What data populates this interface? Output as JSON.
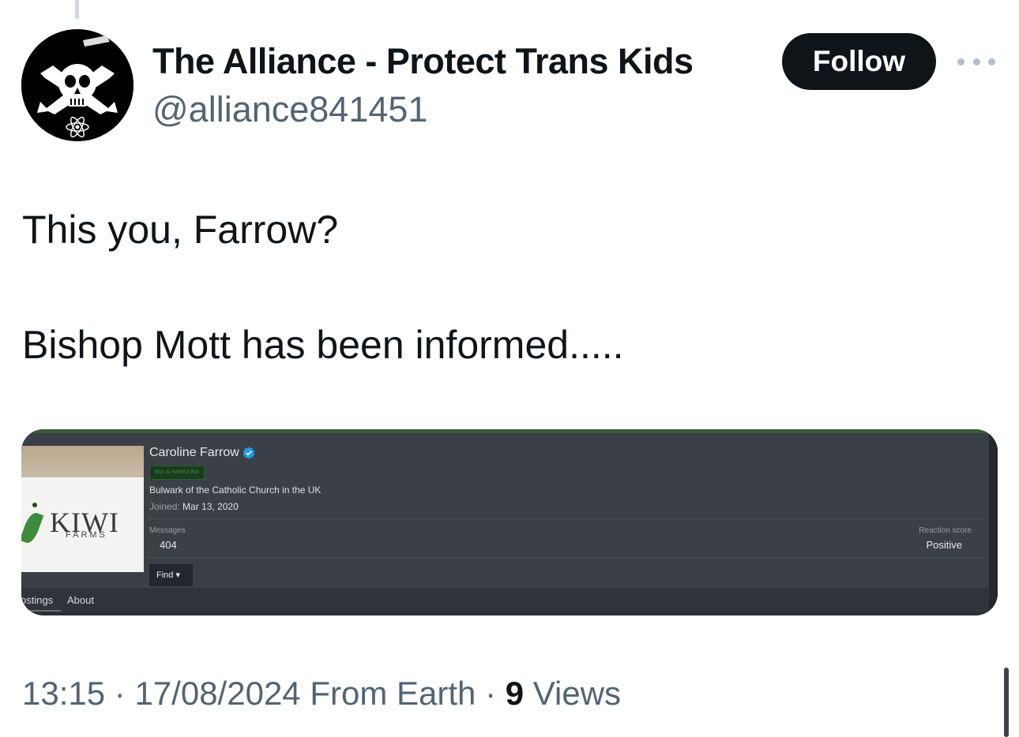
{
  "author": {
    "display_name": "The Alliance - Protect Trans Kids",
    "handle": "@alliance841451",
    "avatar_icon": "skull-crossbones-icon"
  },
  "actions": {
    "follow_label": "Follow",
    "more_icon": "more-dots-icon"
  },
  "tweet": {
    "line1": "This you, Farrow?",
    "line2": "Bishop Mott has been informed....."
  },
  "embed": {
    "profile_name": "Caroline Farrow",
    "verified_icon": "verified-badge-icon",
    "banner_text": "Bun & Hateful Bat",
    "custom_title": "Bulwark of the Catholic Church in the UK",
    "joined_label": "Joined:",
    "joined_date": "Mar 13, 2020",
    "messages_label": "Messages",
    "messages_value": "404",
    "reaction_label": "Reaction score",
    "reaction_value": "Positive",
    "find_label": "Find",
    "tab_postings": "ostings",
    "tab_about": "About",
    "shirt_word": "KIWI",
    "shirt_sub": "FARMS"
  },
  "meta": {
    "time": "13:15",
    "separator": "·",
    "date": "17/08/2024",
    "source": "From Earth",
    "views_count": "9",
    "views_label": "Views"
  },
  "colors": {
    "follow_bg": "#0f1419",
    "muted_text": "#536471",
    "verified_blue": "#1d9bf0"
  }
}
